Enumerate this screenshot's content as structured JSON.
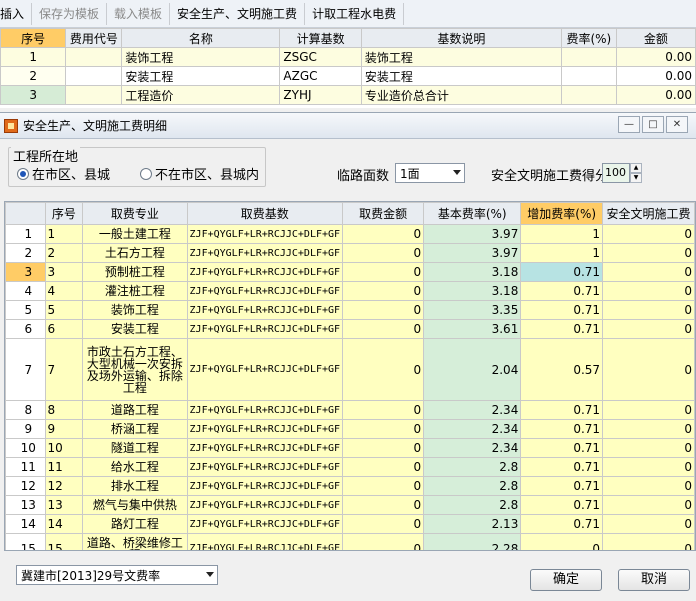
{
  "toolbar": {
    "items": [
      "插入",
      "保存为模板",
      "载入模板",
      "安全生产、文明施工费",
      "计取工程水电费"
    ]
  },
  "top_grid": {
    "headers": [
      "序号",
      "费用代号",
      "名称",
      "计算基数",
      "基数说明",
      "费率(%)",
      "金额"
    ],
    "rows": [
      {
        "no": "1",
        "code": "",
        "name": "装饰工程",
        "base": "ZSGC",
        "desc": "装饰工程",
        "rate": "",
        "amount": "0.00"
      },
      {
        "no": "2",
        "code": "",
        "name": "安装工程",
        "base": "AZGC",
        "desc": "安装工程",
        "rate": "",
        "amount": "0.00"
      },
      {
        "no": "3",
        "code": "",
        "name": "工程造价",
        "base": "ZYHJ",
        "desc": "专业造价总合计",
        "rate": "",
        "amount": "0.00"
      }
    ]
  },
  "dialog": {
    "title": "安全生产、文明施工费明细",
    "location_group": {
      "title": "工程所在地",
      "options": [
        "在市区、县城",
        "不在市区、县城内"
      ],
      "selected": "在市区、县城"
    },
    "road_face_label": "临路面数",
    "road_face_value": "1面",
    "score_label": "安全文明施工费得分",
    "score_value": "100",
    "grid": {
      "headers": [
        "",
        "序号",
        "取费专业",
        "取费基数",
        "取费金额",
        "基本费率(%)",
        "增加费率(%)",
        "安全文明施工费"
      ],
      "rows": [
        {
          "rn": "1",
          "no": "1",
          "spec": "一般土建工程",
          "base": "ZJF+QYGLF+LR+RCJJC+DLF+GF",
          "amount": "0",
          "basic": "3.97",
          "add": "1",
          "fee": "0"
        },
        {
          "rn": "2",
          "no": "2",
          "spec": "土石方工程",
          "base": "ZJF+QYGLF+LR+RCJJC+DLF+GF",
          "amount": "0",
          "basic": "3.97",
          "add": "1",
          "fee": "0"
        },
        {
          "rn": "3",
          "no": "3",
          "spec": "预制桩工程",
          "base": "ZJF+QYGLF+LR+RCJJC+DLF+GF",
          "amount": "0",
          "basic": "3.18",
          "add": "0.71",
          "fee": "0"
        },
        {
          "rn": "4",
          "no": "4",
          "spec": "灌注桩工程",
          "base": "ZJF+QYGLF+LR+RCJJC+DLF+GF",
          "amount": "0",
          "basic": "3.18",
          "add": "0.71",
          "fee": "0"
        },
        {
          "rn": "5",
          "no": "5",
          "spec": "装饰工程",
          "base": "ZJF+QYGLF+LR+RCJJC+DLF+GF",
          "amount": "0",
          "basic": "3.35",
          "add": "0.71",
          "fee": "0"
        },
        {
          "rn": "6",
          "no": "6",
          "spec": "安装工程",
          "base": "ZJF+QYGLF+LR+RCJJC+DLF+GF",
          "amount": "0",
          "basic": "3.61",
          "add": "0.71",
          "fee": "0"
        },
        {
          "rn": "7",
          "no": "7",
          "spec": "市政土石方工程、大型机械一次安拆及场外运输、拆除工程",
          "base": "ZJF+QYGLF+LR+RCJJC+DLF+GF",
          "amount": "0",
          "basic": "2.04",
          "add": "0.57",
          "fee": "0"
        },
        {
          "rn": "8",
          "no": "8",
          "spec": "道路工程",
          "base": "ZJF+QYGLF+LR+RCJJC+DLF+GF",
          "amount": "0",
          "basic": "2.34",
          "add": "0.71",
          "fee": "0"
        },
        {
          "rn": "9",
          "no": "9",
          "spec": "桥涵工程",
          "base": "ZJF+QYGLF+LR+RCJJC+DLF+GF",
          "amount": "0",
          "basic": "2.34",
          "add": "0.71",
          "fee": "0"
        },
        {
          "rn": "10",
          "no": "10",
          "spec": "隧道工程",
          "base": "ZJF+QYGLF+LR+RCJJC+DLF+GF",
          "amount": "0",
          "basic": "2.34",
          "add": "0.71",
          "fee": "0"
        },
        {
          "rn": "11",
          "no": "11",
          "spec": "给水工程",
          "base": "ZJF+QYGLF+LR+RCJJC+DLF+GF",
          "amount": "0",
          "basic": "2.8",
          "add": "0.71",
          "fee": "0"
        },
        {
          "rn": "12",
          "no": "12",
          "spec": "排水工程",
          "base": "ZJF+QYGLF+LR+RCJJC+DLF+GF",
          "amount": "0",
          "basic": "2.8",
          "add": "0.71",
          "fee": "0"
        },
        {
          "rn": "13",
          "no": "13",
          "spec": "燃气与集中供热",
          "base": "ZJF+QYGLF+LR+RCJJC+DLF+GF",
          "amount": "0",
          "basic": "2.8",
          "add": "0.71",
          "fee": "0"
        },
        {
          "rn": "14",
          "no": "14",
          "spec": "路灯工程",
          "base": "ZJF+QYGLF+LR+RCJJC+DLF+GF",
          "amount": "0",
          "basic": "2.13",
          "add": "0.71",
          "fee": "0"
        },
        {
          "rn": "15",
          "no": "15",
          "spec": "道路、桥梁维修工程",
          "base": "ZJF+QYGLF+LR+RCJJC+DLF+GF",
          "amount": "0",
          "basic": "2.28",
          "add": "0",
          "fee": "0"
        }
      ]
    },
    "rate_file": "冀建市[2013]29号文费率",
    "ok_label": "确定",
    "cancel_label": "取消"
  }
}
